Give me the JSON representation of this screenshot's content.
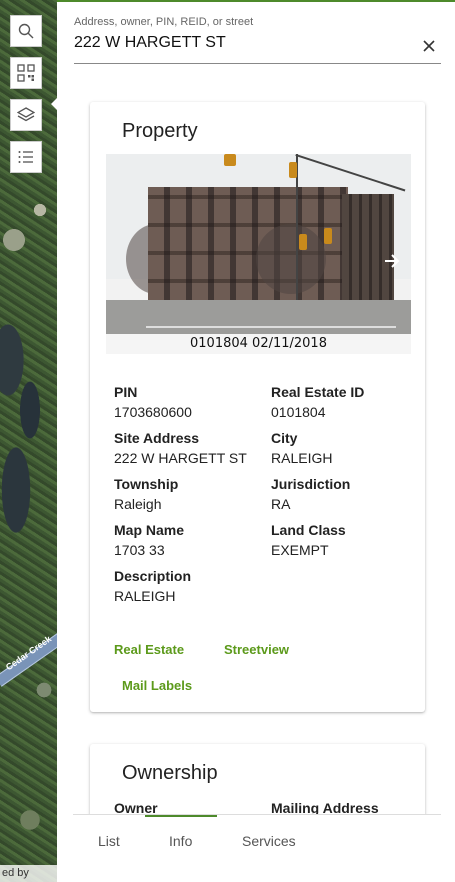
{
  "map": {
    "road_label": "Cedar Creek",
    "attribution": "ed by",
    "tools": [
      {
        "icon": "search-icon"
      },
      {
        "icon": "qr-code-icon"
      },
      {
        "icon": "layers-icon"
      },
      {
        "icon": "list-icon"
      }
    ]
  },
  "search": {
    "label": "Address, owner, PIN, REID, or street",
    "value": "222 W HARGETT ST"
  },
  "property": {
    "title": "Property",
    "photo_caption": "0101804  02/11/2018",
    "fields": [
      {
        "label": "PIN",
        "value": "1703680600"
      },
      {
        "label": "Real Estate ID",
        "value": "0101804"
      },
      {
        "label": "Site Address",
        "value": "222 W HARGETT ST"
      },
      {
        "label": "City",
        "value": "RALEIGH"
      },
      {
        "label": "Township",
        "value": "Raleigh"
      },
      {
        "label": "Jurisdiction",
        "value": "RA"
      },
      {
        "label": "Map Name",
        "value": "1703 33"
      },
      {
        "label": "Land Class",
        "value": "EXEMPT"
      },
      {
        "label": "Description",
        "value": "RALEIGH"
      }
    ],
    "links": {
      "real_estate": "Real Estate",
      "streetview": "Streetview",
      "mail_labels": "Mail Labels"
    }
  },
  "ownership": {
    "title": "Ownership",
    "owner_label": "Owner",
    "mailing_label": "Mailing Address"
  },
  "tabs": {
    "list": "List",
    "info": "Info",
    "services": "Services",
    "active": "Info"
  },
  "colors": {
    "accent": "#5c9a1b",
    "top_bar": "#4d8a2b"
  }
}
